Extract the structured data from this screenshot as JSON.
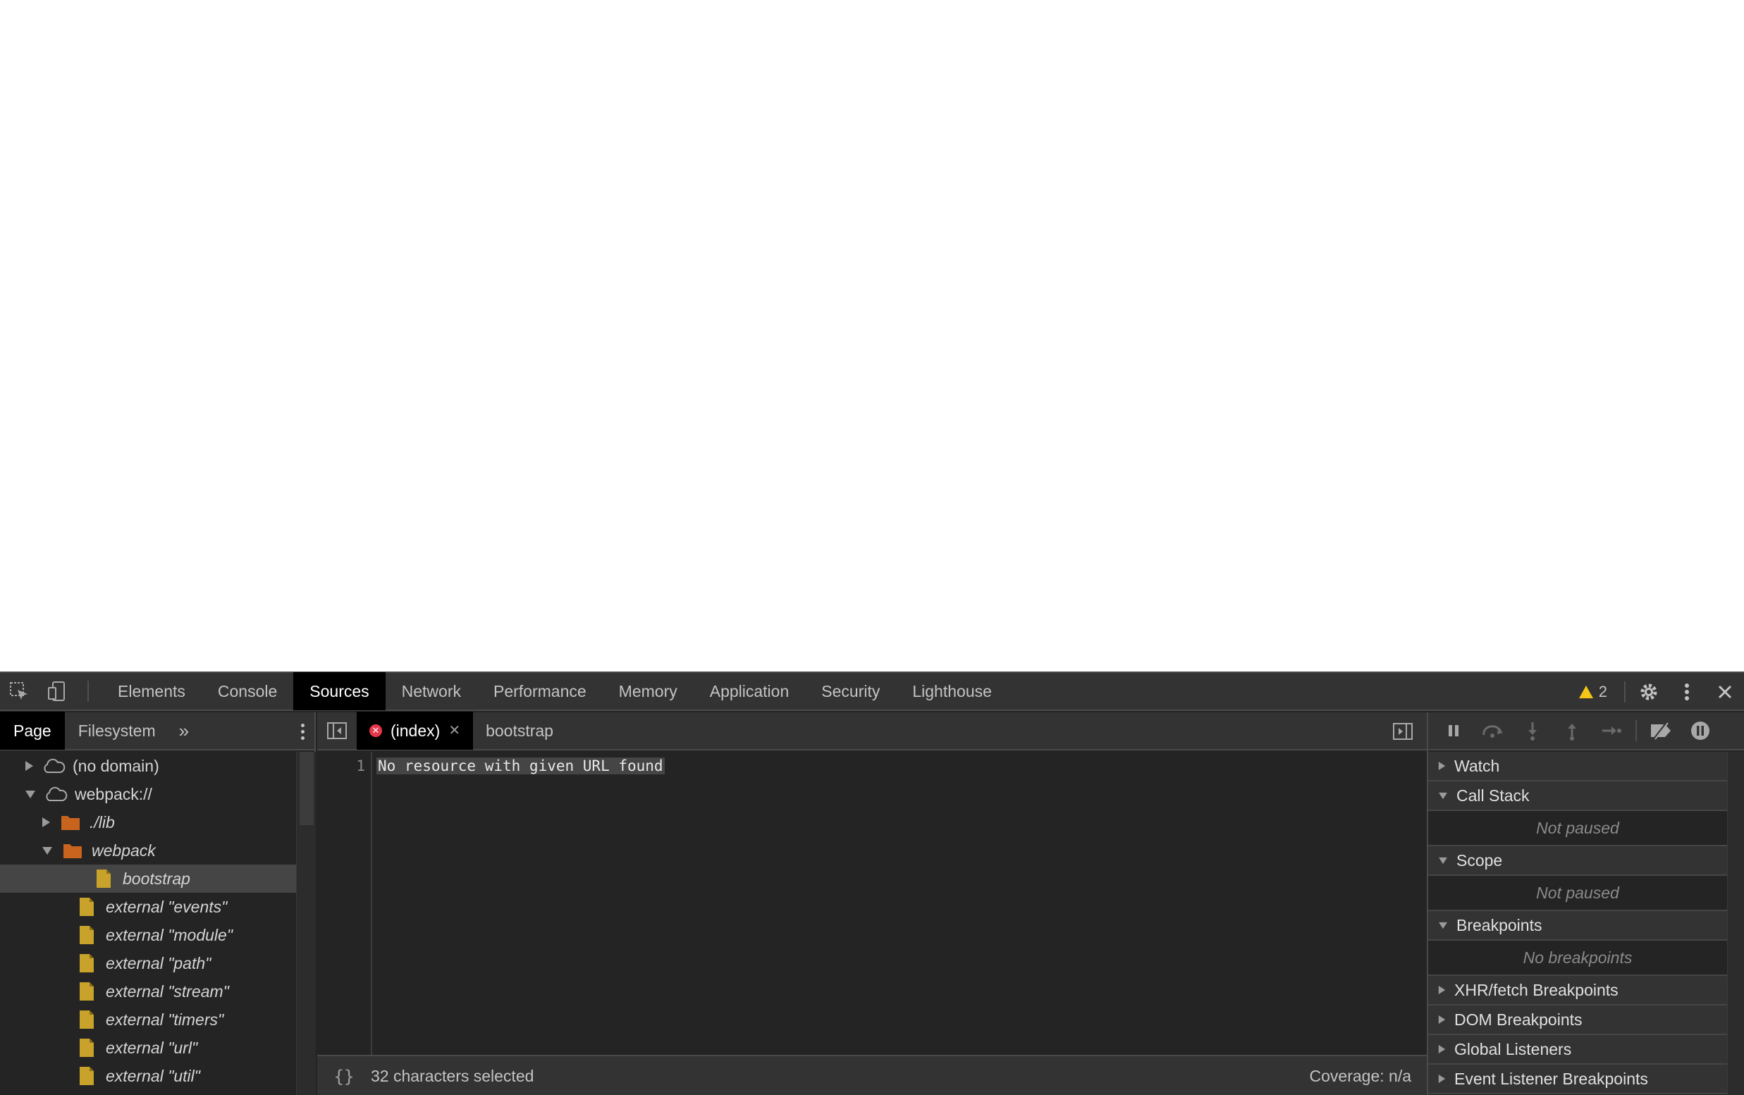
{
  "toolbar": {
    "tabs": [
      {
        "label": "Elements"
      },
      {
        "label": "Console"
      },
      {
        "label": "Sources"
      },
      {
        "label": "Network"
      },
      {
        "label": "Performance"
      },
      {
        "label": "Memory"
      },
      {
        "label": "Application"
      },
      {
        "label": "Security"
      },
      {
        "label": "Lighthouse"
      }
    ],
    "active_tab": "Sources",
    "warning_count": "2"
  },
  "navigator": {
    "tabs": [
      {
        "label": "Page"
      },
      {
        "label": "Filesystem"
      }
    ],
    "more_label": "»",
    "tree": [
      {
        "label": "(no domain)",
        "type": "domain",
        "expanded": false,
        "depth": 0
      },
      {
        "label": "webpack://",
        "type": "domain",
        "expanded": true,
        "depth": 0
      },
      {
        "label": "./lib",
        "type": "folder",
        "expanded": false,
        "depth": 1
      },
      {
        "label": "webpack",
        "type": "folder",
        "expanded": true,
        "depth": 1
      },
      {
        "label": "bootstrap",
        "type": "file",
        "depth": 2,
        "selected": true
      },
      {
        "label": "external \"events\"",
        "type": "file",
        "depth": 1
      },
      {
        "label": "external \"module\"",
        "type": "file",
        "depth": 1
      },
      {
        "label": "external \"path\"",
        "type": "file",
        "depth": 1
      },
      {
        "label": "external \"stream\"",
        "type": "file",
        "depth": 1
      },
      {
        "label": "external \"timers\"",
        "type": "file",
        "depth": 1
      },
      {
        "label": "external \"url\"",
        "type": "file",
        "depth": 1
      },
      {
        "label": "external \"util\"",
        "type": "file",
        "depth": 1
      }
    ]
  },
  "editor": {
    "tabs": [
      {
        "label": "(index)",
        "active": true,
        "error": true
      },
      {
        "label": "bootstrap",
        "active": false
      }
    ],
    "line_number": "1",
    "code": "No resource with given URL found",
    "braces": "{}",
    "status": "32 characters selected",
    "coverage": "Coverage: n/a"
  },
  "debugger": {
    "panes": [
      {
        "title": "Watch",
        "expanded": false
      },
      {
        "title": "Call Stack",
        "expanded": true,
        "body": "Not paused"
      },
      {
        "title": "Scope",
        "expanded": true,
        "body": "Not paused"
      },
      {
        "title": "Breakpoints",
        "expanded": true,
        "body": "No breakpoints"
      },
      {
        "title": "XHR/fetch Breakpoints",
        "expanded": false
      },
      {
        "title": "DOM Breakpoints",
        "expanded": false
      },
      {
        "title": "Global Listeners",
        "expanded": false
      },
      {
        "title": "Event Listener Breakpoints",
        "expanded": false
      }
    ]
  },
  "colors": {
    "panel_bg": "#242424",
    "toolbar_bg": "#333333",
    "folder": "#c8641e",
    "file": "#c8a22a",
    "error": "#e8364a",
    "warning": "#f5c518"
  }
}
